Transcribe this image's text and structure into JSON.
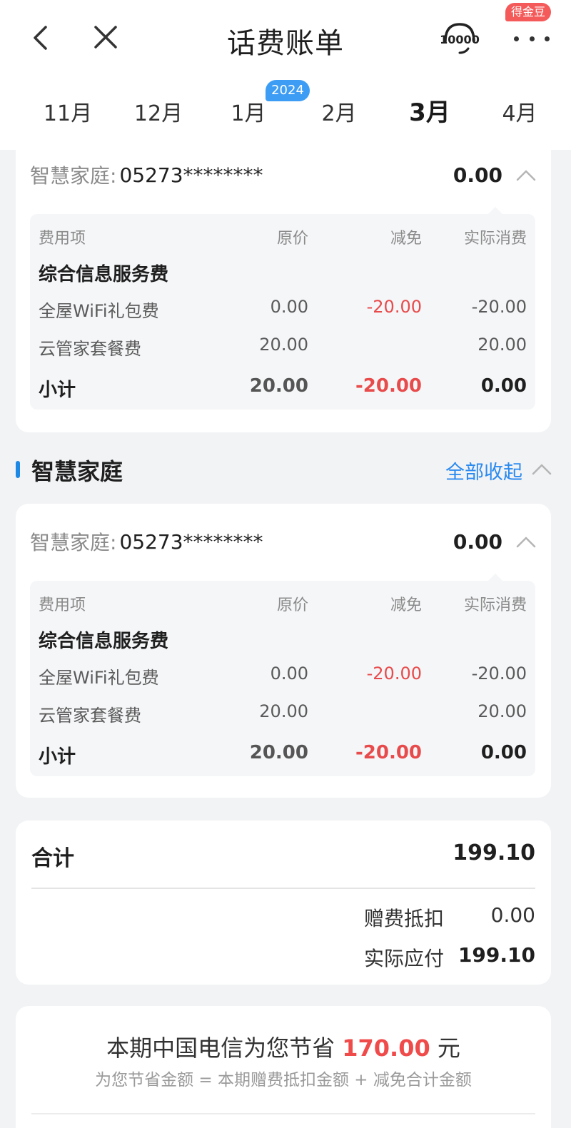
{
  "header": {
    "title": "话费账单",
    "service_icon_text": "10000",
    "reward_badge": "得金豆"
  },
  "months": {
    "tabs": [
      "11月",
      "12月",
      "1月",
      "2月",
      "3月",
      "4月"
    ],
    "active": "3月",
    "year_badge": "2024"
  },
  "top_account": {
    "label": "智慧家庭:",
    "number": "05273********",
    "total": "0.00",
    "fee_header": [
      "费用项",
      "原价",
      "减免",
      "实际消费"
    ],
    "category": "综合信息服务费",
    "items": [
      {
        "name": "全屋WiFi礼包费",
        "original": "0.00",
        "discount": "-20.00",
        "actual": "-20.00"
      },
      {
        "name": "云管家套餐费",
        "original": "20.00",
        "discount": "",
        "actual": "20.00"
      }
    ],
    "subtotal": {
      "label": "小计",
      "original": "20.00",
      "discount": "-20.00",
      "actual": "0.00"
    }
  },
  "section": {
    "title": "智慧家庭",
    "collapse_all": "全部收起"
  },
  "mid_account": {
    "label": "智慧家庭:",
    "number": "05273********",
    "total": "0.00",
    "fee_header": [
      "费用项",
      "原价",
      "减免",
      "实际消费"
    ],
    "category": "综合信息服务费",
    "items": [
      {
        "name": "全屋WiFi礼包费",
        "original": "0.00",
        "discount": "-20.00",
        "actual": "-20.00"
      },
      {
        "name": "云管家套餐费",
        "original": "20.00",
        "discount": "",
        "actual": "20.00"
      }
    ],
    "subtotal": {
      "label": "小计",
      "original": "20.00",
      "discount": "-20.00",
      "actual": "0.00"
    }
  },
  "summary": {
    "total_label": "合计",
    "total_value": "199.10",
    "gift_label": "赠费抵扣",
    "gift_value": "0.00",
    "payable_label": "实际应付",
    "payable_value": "199.10"
  },
  "savings": {
    "prefix": "本期中国电信为您节省",
    "amount": "170.00",
    "unit": "元",
    "formula": "为您节省金额 = 本期赠费抵扣金额 + 减免合计金额"
  },
  "colors": {
    "accent_blue": "#1e88e5",
    "link_blue": "#2a8af0",
    "negative_red": "#e84b4b",
    "badge_red": "#f45a5a",
    "background": "#f2f3f5"
  }
}
